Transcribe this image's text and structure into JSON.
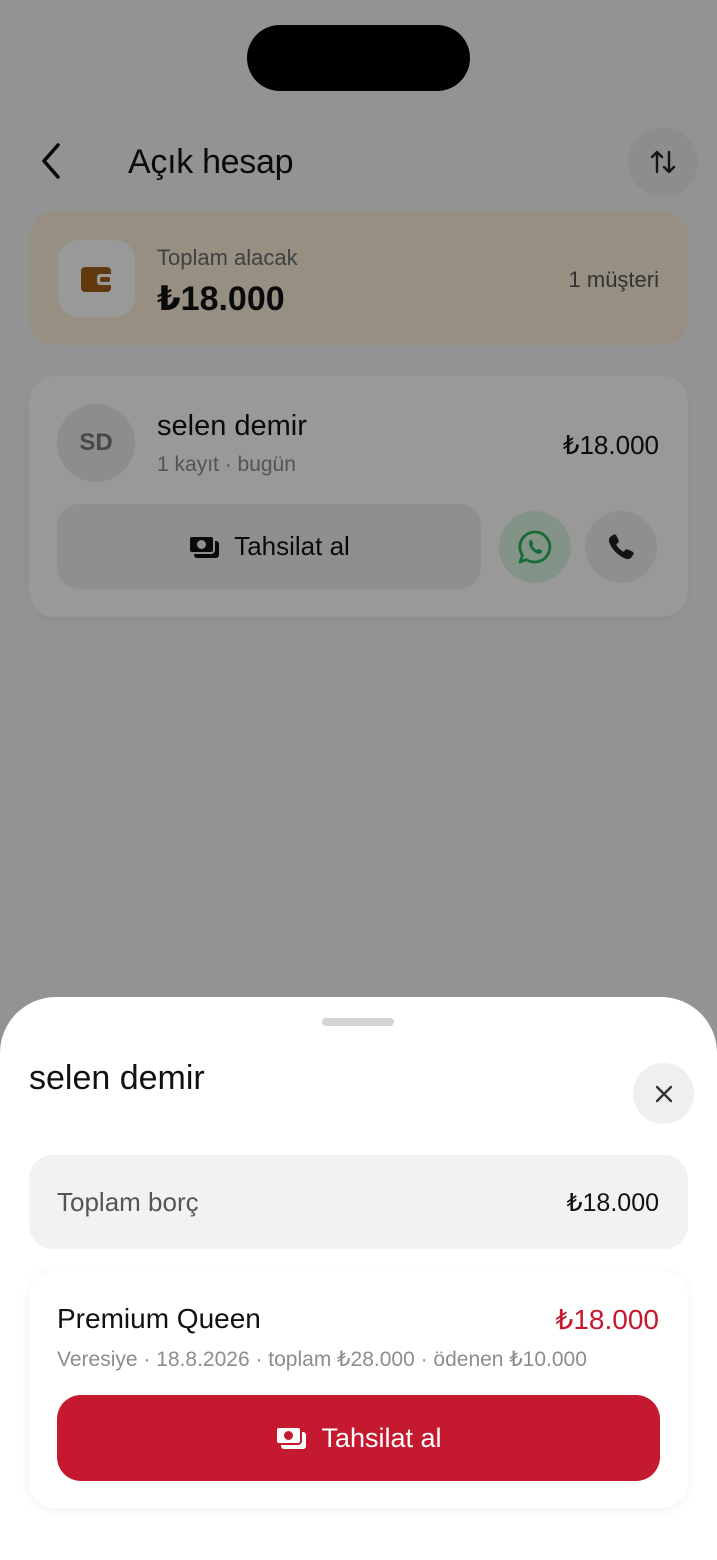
{
  "nav": {
    "title": "Açık hesap"
  },
  "summary": {
    "label": "Toplam alacak",
    "amount": "₺18.000",
    "customer_count": "1 müşteri"
  },
  "customer": {
    "initials": "SD",
    "name": "selen demir",
    "subtitle": "1 kayıt · bugün",
    "amount": "₺18.000",
    "collect_label": "Tahsilat al"
  },
  "sheet": {
    "title": "selen demir",
    "total_debt_label": "Toplam borç",
    "total_debt_amount": "₺18.000",
    "item": {
      "name": "Premium Queen",
      "amount": "₺18.000",
      "meta": "Veresiye · 18.8.2026 · toplam ₺28.000 · ödenen ₺10.000",
      "collect_label": "Tahsilat al"
    }
  },
  "icons": {
    "back": "chevron-left-icon",
    "sort": "sort-arrows-icon",
    "wallet": "wallet-icon",
    "cash": "cash-icon",
    "whatsapp": "whatsapp-icon",
    "phone": "phone-icon",
    "close": "close-icon"
  },
  "colors": {
    "accent_red": "#c4192f",
    "summary_bg": "#fbefd9",
    "wallet_brown": "#a0601a",
    "whatsapp_green": "#25b35a"
  }
}
